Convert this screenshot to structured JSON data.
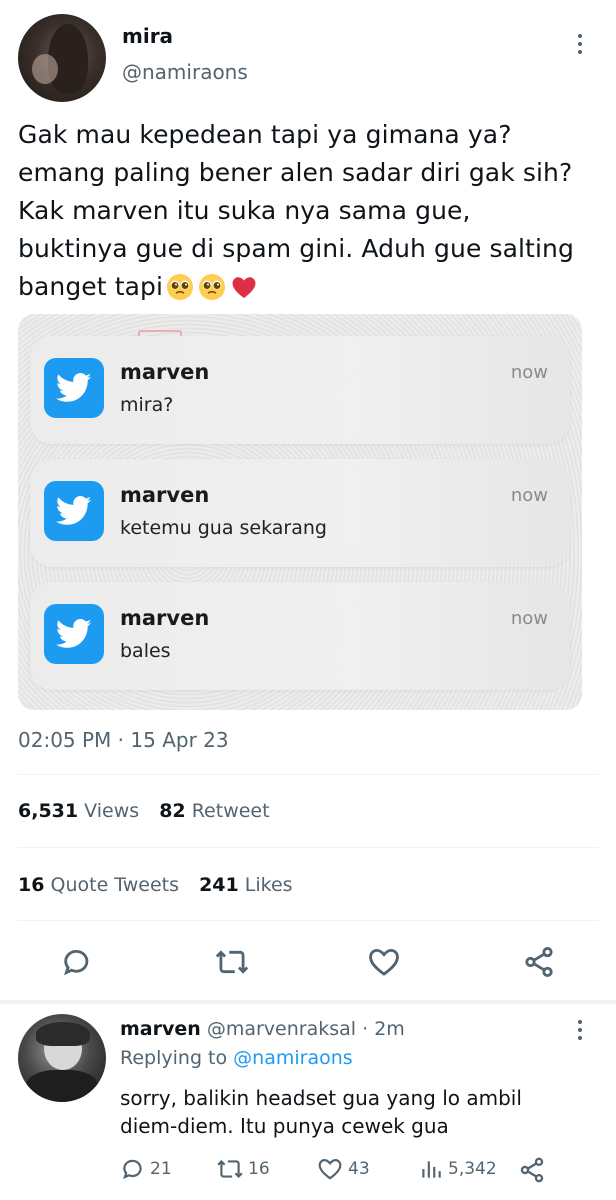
{
  "author": {
    "name": "mira",
    "handle": "@namiraons"
  },
  "tweet": {
    "lines": [
      "Gak mau kepedean tapi ya gimana ya?",
      "emang paling bener alen sadar diri gak sih?",
      "Kak marven itu suka nya sama gue,",
      "buktinya gue di spam gini. Aduh gue salting",
      "banget tapi"
    ],
    "emojis": [
      "pleading-face-emoji",
      "pleading-face-emoji",
      "red-heart-emoji"
    ],
    "timestamp": "02:05 PM · 15 Apr 23"
  },
  "notifications": [
    {
      "app_icon": "twitter-bird-icon",
      "title": "marven",
      "body": "mira?",
      "time": "now"
    },
    {
      "app_icon": "twitter-bird-icon",
      "title": "marven",
      "body": "ketemu gua sekarang",
      "time": "now"
    },
    {
      "app_icon": "twitter-bird-icon",
      "title": "marven",
      "body": "bales",
      "time": "now"
    }
  ],
  "stats": {
    "views_count": "6,531",
    "views_label": "Views",
    "retweets_count": "82",
    "retweets_label": "Retweet",
    "quotes_count": "16",
    "quotes_label": "Quote Tweets",
    "likes_count": "241",
    "likes_label": "Likes"
  },
  "reply": {
    "name": "marven",
    "handle": "@marvenraksal",
    "separator": "·",
    "time": "2m",
    "replying_prefix": "Replying to",
    "replying_handle": "@namiraons",
    "text_line1": "sorry, balikin headset gua yang lo ambil",
    "text_line2": "diem-diem. Itu punya cewek gua",
    "reply_count": "21",
    "retweet_count": "16",
    "like_count": "43",
    "view_count": "5,342"
  },
  "colors": {
    "accent": "#1d9bf0",
    "muted": "#536471",
    "heart": "#e0245e"
  }
}
